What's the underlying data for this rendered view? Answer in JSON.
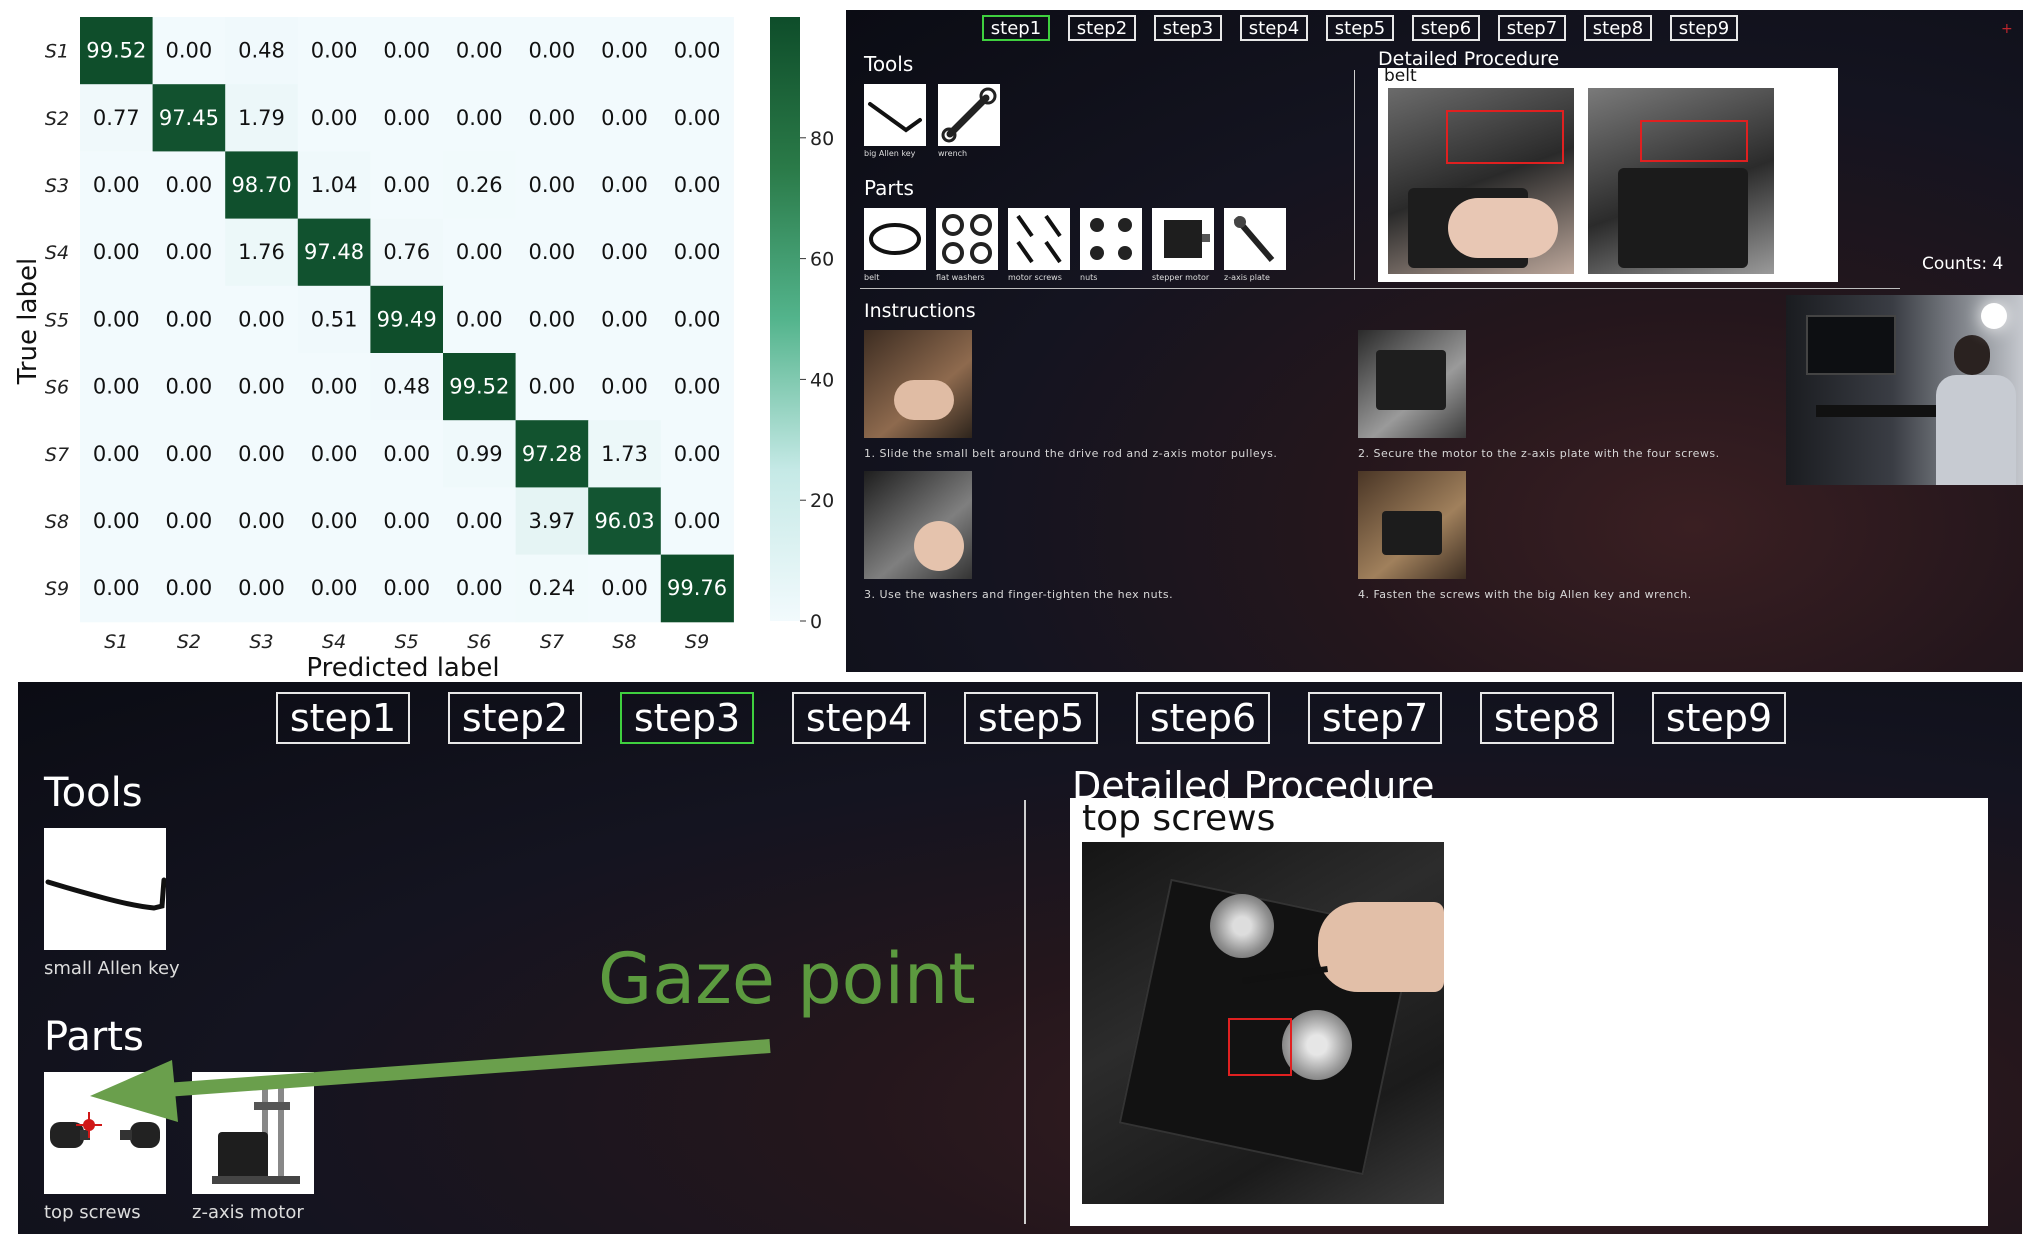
{
  "confusion_matrix": {
    "xlabel": "Predicted label",
    "ylabel": "True label",
    "labels": [
      "S1",
      "S2",
      "S3",
      "S4",
      "S5",
      "S6",
      "S7",
      "S8",
      "S9"
    ],
    "colorbar_ticks": [
      "0",
      "20",
      "40",
      "60",
      "80"
    ]
  },
  "chart_data": {
    "type": "heatmap",
    "title": "",
    "xlabel": "Predicted label",
    "ylabel": "True label",
    "x": [
      "S1",
      "S2",
      "S3",
      "S4",
      "S5",
      "S6",
      "S7",
      "S8",
      "S9"
    ],
    "y": [
      "S1",
      "S2",
      "S3",
      "S4",
      "S5",
      "S6",
      "S7",
      "S8",
      "S9"
    ],
    "values": [
      [
        99.52,
        0.0,
        0.48,
        0.0,
        0.0,
        0.0,
        0.0,
        0.0,
        0.0
      ],
      [
        0.77,
        97.45,
        1.79,
        0.0,
        0.0,
        0.0,
        0.0,
        0.0,
        0.0
      ],
      [
        0.0,
        0.0,
        98.7,
        1.04,
        0.0,
        0.26,
        0.0,
        0.0,
        0.0
      ],
      [
        0.0,
        0.0,
        1.76,
        97.48,
        0.76,
        0.0,
        0.0,
        0.0,
        0.0
      ],
      [
        0.0,
        0.0,
        0.0,
        0.51,
        99.49,
        0.0,
        0.0,
        0.0,
        0.0
      ],
      [
        0.0,
        0.0,
        0.0,
        0.0,
        0.48,
        99.52,
        0.0,
        0.0,
        0.0
      ],
      [
        0.0,
        0.0,
        0.0,
        0.0,
        0.0,
        0.99,
        97.28,
        1.73,
        0.0
      ],
      [
        0.0,
        0.0,
        0.0,
        0.0,
        0.0,
        0.0,
        3.97,
        96.03,
        0.0
      ],
      [
        0.0,
        0.0,
        0.0,
        0.0,
        0.0,
        0.0,
        0.24,
        0.0,
        99.76
      ]
    ],
    "colorbar_range": [
      0,
      100
    ],
    "colorbar_ticks": [
      0,
      20,
      40,
      60,
      80
    ],
    "colors": {
      "low": "#f2fafd",
      "mid": "#53b48c",
      "high": "#0e4d2a"
    }
  },
  "ui_small": {
    "steps": [
      "step1",
      "step2",
      "step3",
      "step4",
      "step5",
      "step6",
      "step7",
      "step8",
      "step9"
    ],
    "active_step": 0,
    "tools_title": "Tools",
    "tools": [
      {
        "name": "big Allen key",
        "icon": "allen-key-icon"
      },
      {
        "name": "wrench",
        "icon": "wrench-icon"
      }
    ],
    "parts_title": "Parts",
    "parts": [
      {
        "name": "belt",
        "icon": "belt-icon"
      },
      {
        "name": "flat washers",
        "icon": "washers-icon"
      },
      {
        "name": "motor screws",
        "icon": "screws-icon"
      },
      {
        "name": "nuts",
        "icon": "nuts-icon"
      },
      {
        "name": "stepper motor",
        "icon": "stepper-motor-icon"
      },
      {
        "name": "z-axis plate",
        "icon": "z-axis-plate-icon"
      }
    ],
    "procedure_title": "Detailed Procedure",
    "procedure_item": "belt",
    "counts": "Counts: 4",
    "instructions_title": "Instructions",
    "instructions": [
      "1. Slide the small belt around the drive rod and z-axis motor pulleys.",
      "2. Secure the motor to the z-axis plate with the four screws.",
      "3. Use the washers and finger-tighten the hex nuts.",
      "4. Fasten the screws with the big Allen key and wrench."
    ]
  },
  "ui_large": {
    "steps": [
      "step1",
      "step2",
      "step3",
      "step4",
      "step5",
      "step6",
      "step7",
      "step8",
      "step9"
    ],
    "active_step": 2,
    "tools_title": "Tools",
    "tools": [
      {
        "name": "small Allen key",
        "icon": "allen-key-icon"
      }
    ],
    "parts_title": "Parts",
    "parts": [
      {
        "name": "top screws",
        "icon": "screws-icon"
      },
      {
        "name": "z-axis motor",
        "icon": "z-axis-motor-icon"
      }
    ],
    "procedure_title": "Detailed Procedure",
    "procedure_item": "top screws",
    "gaze_label": "Gaze point",
    "gaze_color": "#6a9f4c"
  }
}
